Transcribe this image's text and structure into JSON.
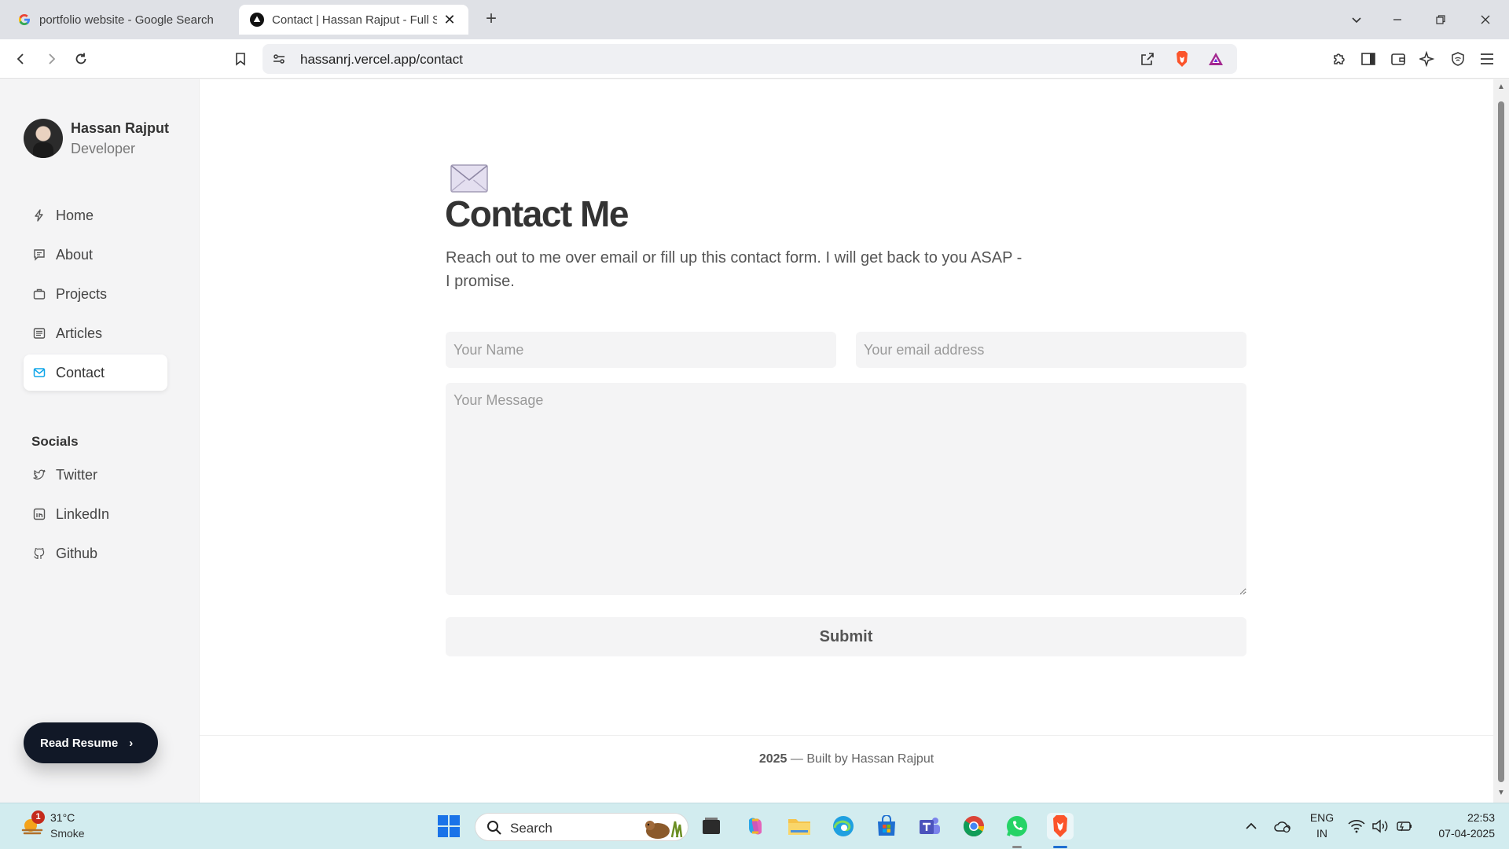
{
  "browser": {
    "tabs": [
      {
        "title": "portfolio website - Google Search",
        "favicon": "google-icon"
      },
      {
        "title": "Contact | Hassan Rajput - Full S",
        "favicon": "vercel-triangle-icon",
        "active": true
      }
    ],
    "url": "hassanrj.vercel.app/contact"
  },
  "profile": {
    "name": "Hassan Rajput",
    "role": "Developer"
  },
  "nav": {
    "items": [
      {
        "label": "Home",
        "icon": "bolt-icon"
      },
      {
        "label": "About",
        "icon": "message-icon"
      },
      {
        "label": "Projects",
        "icon": "briefcase-icon"
      },
      {
        "label": "Articles",
        "icon": "article-icon"
      },
      {
        "label": "Contact",
        "icon": "mail-icon",
        "active": true
      }
    ]
  },
  "socials": {
    "heading": "Socials",
    "items": [
      {
        "label": "Twitter",
        "icon": "twitter-icon"
      },
      {
        "label": "LinkedIn",
        "icon": "linkedin-icon"
      },
      {
        "label": "Github",
        "icon": "github-icon"
      }
    ]
  },
  "resume": {
    "label": "Read Resume"
  },
  "contact": {
    "title": "Contact Me",
    "lead": "Reach out to me over email or fill up this contact form. I will get back to you ASAP - I promise.",
    "name_placeholder": "Your Name",
    "email_placeholder": "Your email address",
    "message_placeholder": "Your Message",
    "submit_label": "Submit"
  },
  "footer": {
    "year": "2025",
    "text": " — Built by Hassan Rajput"
  },
  "taskbar": {
    "weather": {
      "temp": "31°C",
      "condition": "Smoke",
      "badge": "1"
    },
    "search_label": "Search",
    "lang_top": "ENG",
    "lang_bottom": "IN",
    "time": "22:53",
    "date": "07-04-2025"
  },
  "colors": {
    "accent_active_nav_icon": "#0ea5e9",
    "resume_button": "#111827",
    "brave_orange": "#fb542b"
  }
}
